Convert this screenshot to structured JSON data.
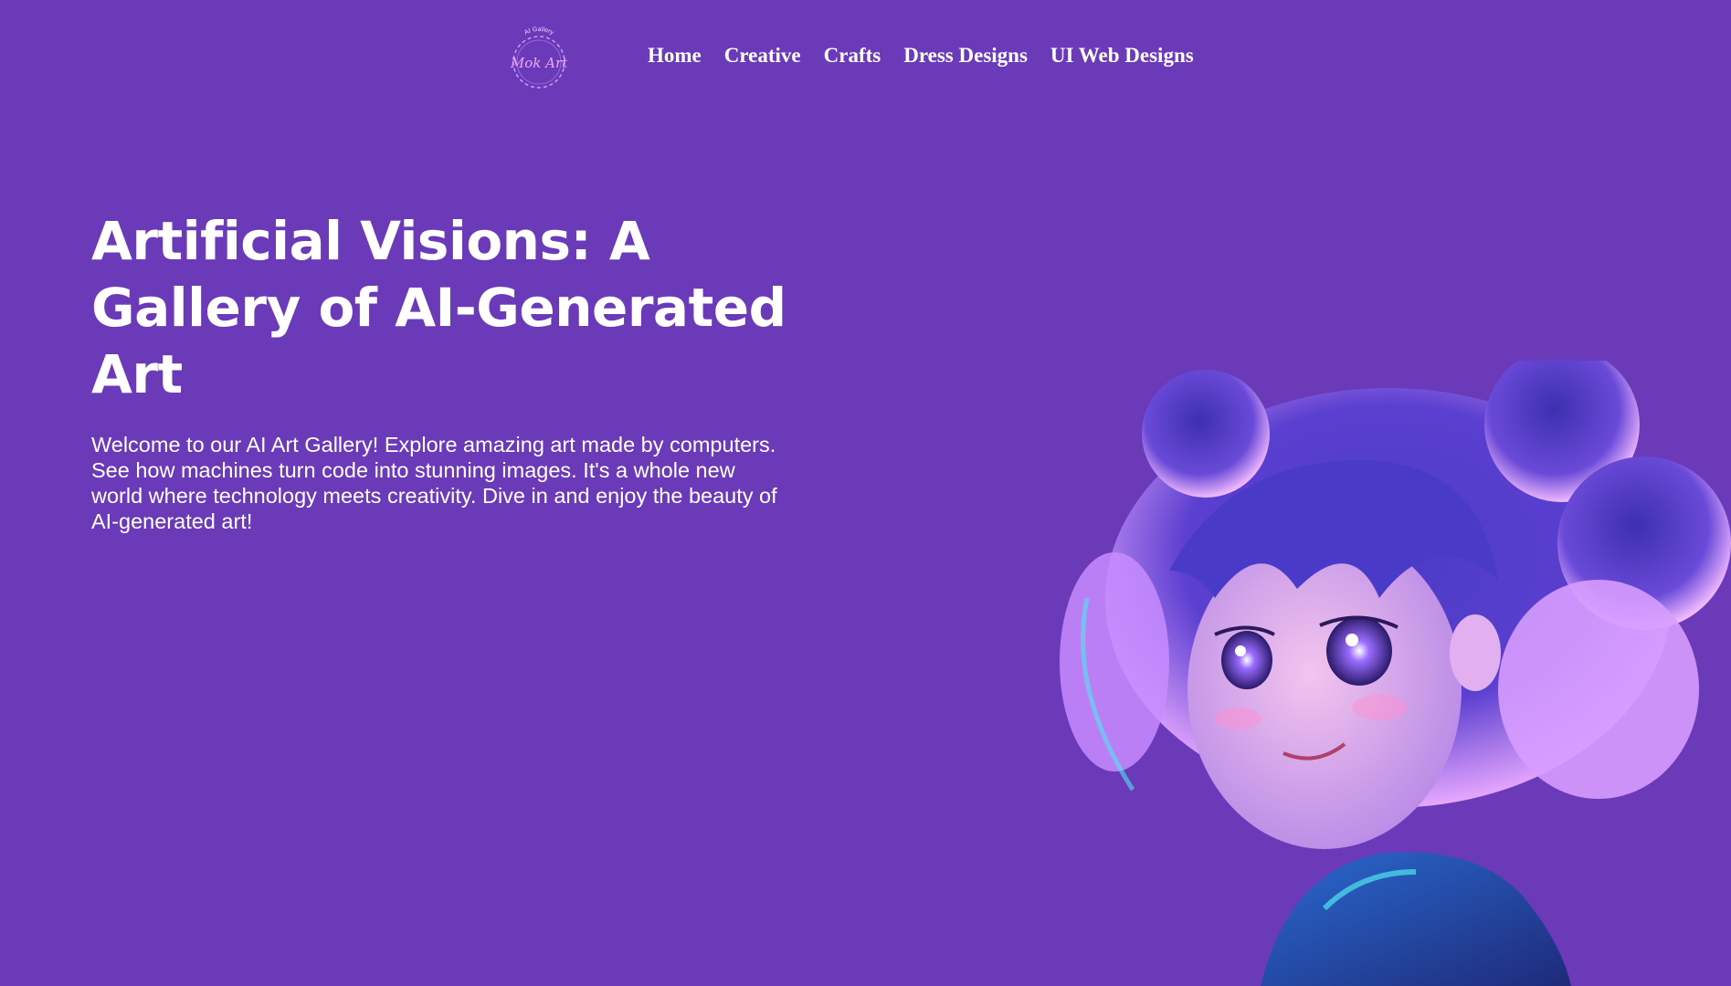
{
  "logo": {
    "small_text": "AI Gallery",
    "script_text": "Mok Art",
    "icon": "circle-wreath-logo"
  },
  "nav": {
    "items": [
      {
        "label": "Home"
      },
      {
        "label": "Creative"
      },
      {
        "label": "Crafts"
      },
      {
        "label": "Dress Designs"
      },
      {
        "label": "UI Web Designs"
      }
    ]
  },
  "hero": {
    "title": "Artificial Visions: A Gallery of AI-Generated Art",
    "description": "Welcome to our AI Art Gallery! Explore amazing art made by computers. See how machines turn code into stunning images. It's a whole new world where technology meets creativity. Dive in and enjoy the beauty of AI-generated art!",
    "image_icon": "anime-girl-illustration"
  },
  "colors": {
    "background": "#6b3ab8",
    "text": "#ffffff",
    "hair_dark": "#3a2fa8",
    "hair_glow": "#e7a8ff",
    "accent_cyan": "#4ee6f0"
  }
}
